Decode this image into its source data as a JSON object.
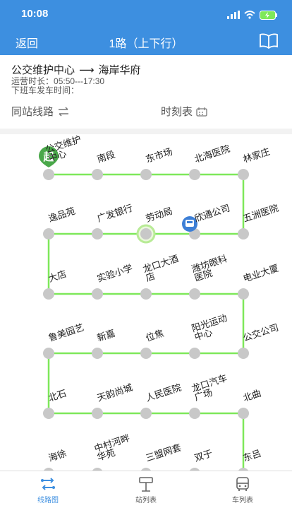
{
  "status": {
    "time": "10:08"
  },
  "nav": {
    "back_label": "返回",
    "title": "1路（上下行）"
  },
  "route": {
    "from": "公交维护中心",
    "arrow": "⟶",
    "to": "海岸华府",
    "hours_label": "运营时长：",
    "hours": "05:50---17:30",
    "last_label": "下班车发车时间："
  },
  "tools": {
    "same_stop": "同站线路",
    "timetable": "时刻表"
  },
  "badges": {
    "start": "起"
  },
  "stops": [
    "公交维护中心",
    "南段",
    "东市场",
    "北海医院",
    "林家庄",
    "五洲医院",
    "欣通公司",
    "劳动局",
    "广发银行",
    "逸品苑",
    "大店",
    "实验小学",
    "龙口大酒店",
    "潍坊眼科医院",
    "电业大厦",
    "公交公司",
    "阳光运动中心",
    "位焦",
    "新嘉",
    "鲁美园艺",
    "北石",
    "天韵尚城",
    "人民医院",
    "龙口汽车广场",
    "北曲",
    "东吕",
    "双于",
    "三盟网套",
    "中村河畔华苑",
    "海徐"
  ],
  "tabs": [
    {
      "label": "线路图",
      "icon": "route-map-icon",
      "active": true
    },
    {
      "label": "站列表",
      "icon": "bus-stop-icon",
      "active": false
    },
    {
      "label": "车列表",
      "icon": "bus-icon",
      "active": false
    }
  ],
  "colors": {
    "primary": "#3d8fe0",
    "line": "#7ee85a",
    "stop": "#c8c8c8",
    "start_badge": "#4aa84a",
    "bus_badge": "#3d7fd6"
  }
}
